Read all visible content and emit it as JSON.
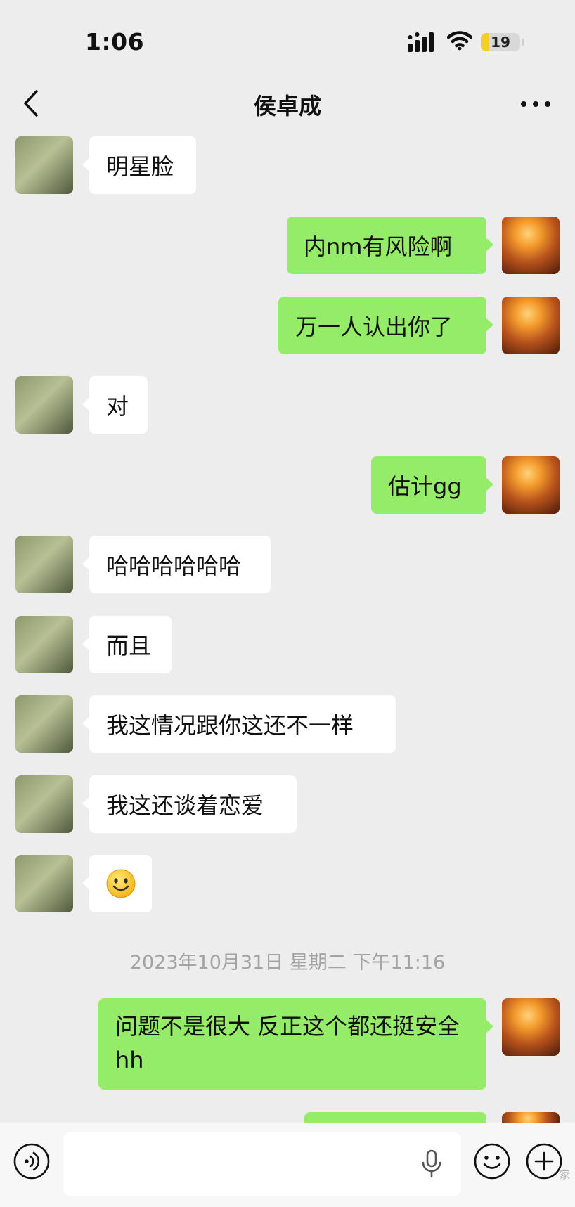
{
  "status_bar": {
    "time": "1:06",
    "battery": "19",
    "battery_level": 0.19
  },
  "nav": {
    "title": "侯卓成"
  },
  "messages": [
    {
      "side": "in",
      "text": "明星脸"
    },
    {
      "side": "out",
      "text": "内nm有风险啊"
    },
    {
      "side": "out",
      "text": "万一人认出你了"
    },
    {
      "side": "in",
      "text": "对"
    },
    {
      "side": "out",
      "text": "估计gg"
    },
    {
      "side": "in",
      "text": "哈哈哈哈哈哈"
    },
    {
      "side": "in",
      "text": "而且"
    },
    {
      "side": "in",
      "text": "我这情况跟你这还不一样"
    },
    {
      "side": "in",
      "text": "我这还谈着恋爱"
    },
    {
      "side": "in",
      "emoji": "smile-emoji"
    },
    {
      "side": "out",
      "text": "问题不是很大 反正这个都还挺安全hh"
    }
  ],
  "timestamp": "2023年10月31日 星期二 下午11:16",
  "input": {
    "value": "",
    "placeholder": ""
  },
  "watermark": "家",
  "icons": {
    "back": "chevron-left-icon",
    "more": "more-dots-icon",
    "voice": "voice-icon",
    "mic": "microphone-icon",
    "emoji": "emoji-icon",
    "plus": "plus-icon"
  },
  "colors": {
    "background": "#ededed",
    "bubble_out": "#95ec69",
    "bubble_in": "#ffffff",
    "battery": "#f5cc2b"
  }
}
